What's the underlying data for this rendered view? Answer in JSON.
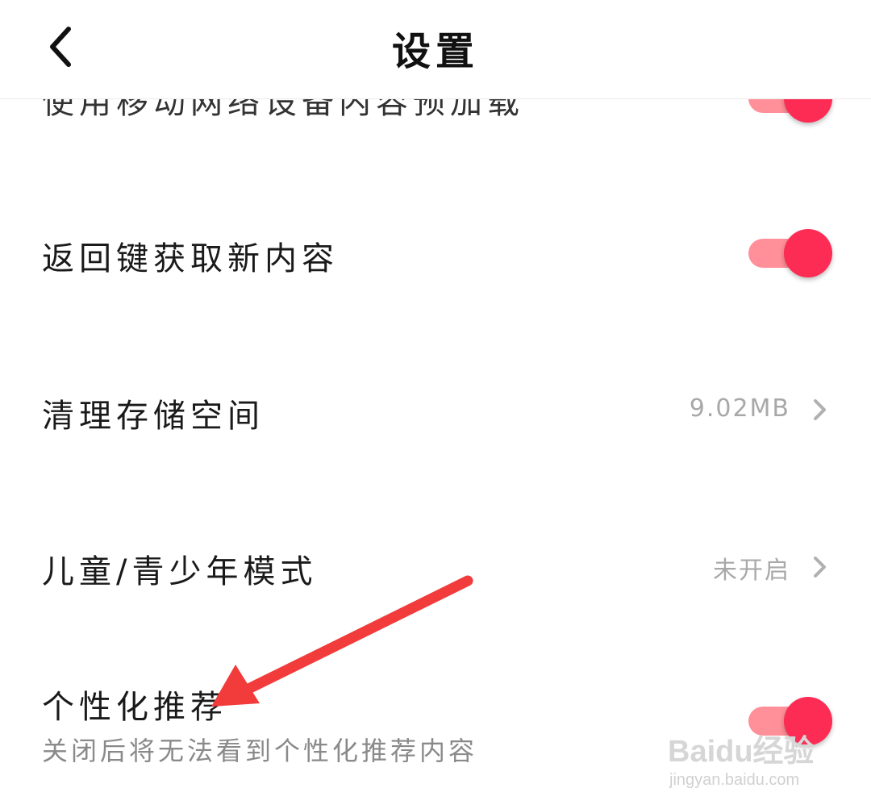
{
  "header": {
    "title": "设置",
    "back_icon": "chevron-left-icon"
  },
  "settings": {
    "partial_item": {
      "label": "使用移动网络设备内容预加载",
      "toggle_on": true
    },
    "back_key_refresh": {
      "label": "返回键获取新内容",
      "toggle_on": true
    },
    "clear_storage": {
      "label": "清理存储空间",
      "value": "9.02MB"
    },
    "teen_mode": {
      "label": "儿童/青少年模式",
      "value": "未开启"
    },
    "personalized": {
      "label": "个性化推荐",
      "description": "关闭后将无法看到个性化推荐内容",
      "toggle_on": true
    }
  },
  "colors": {
    "toggle_track": "#ff8f98",
    "toggle_knob": "#fc2c55",
    "annotation_arrow": "#f23b3b"
  },
  "watermark": {
    "logo": "Baidu经验",
    "url": "jingyan.baidu.com"
  }
}
